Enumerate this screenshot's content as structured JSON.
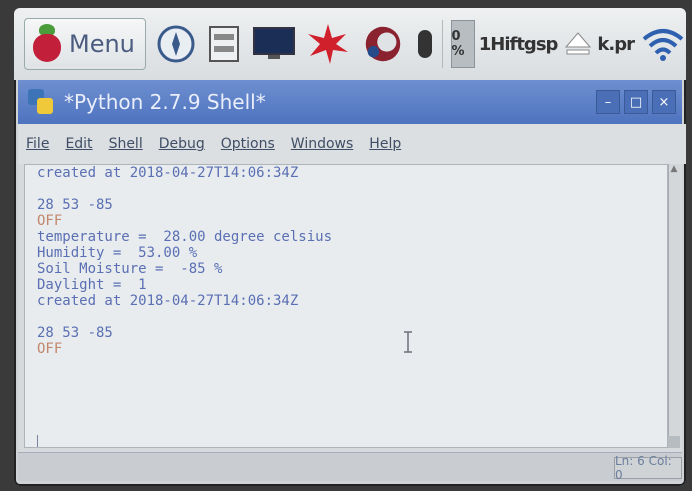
{
  "panel": {
    "menu_label": "Menu",
    "cpu_usage": "0 %",
    "ticker_text": "1Hiftgsp",
    "ticker_text2": "k.pr"
  },
  "window": {
    "title": "*Python 2.7.9 Shell*",
    "buttons": [
      "–",
      "□",
      "×"
    ]
  },
  "menubar": {
    "items": [
      "File",
      "Edit",
      "Shell",
      "Debug",
      "Options",
      "Windows",
      "Help"
    ]
  },
  "shell": {
    "lines": [
      "created at 2018-04-27T14:06:34Z",
      "",
      "28 53 -85",
      "OFF",
      "temperature =  28.00 degree celsius",
      "Humidity =  53.00 %",
      "Soil Moisture =  -85 %",
      "Daylight =  1",
      "created at 2018-04-27T14:06:34Z",
      "",
      "28 53 -85",
      "OFF"
    ]
  },
  "statusbar": {
    "text": "Ln: 6 Col: 0"
  },
  "colors": {
    "titlebar": "#4e73bf",
    "shell_text": "#5a6fb4",
    "shell_output": "#c2866a"
  }
}
